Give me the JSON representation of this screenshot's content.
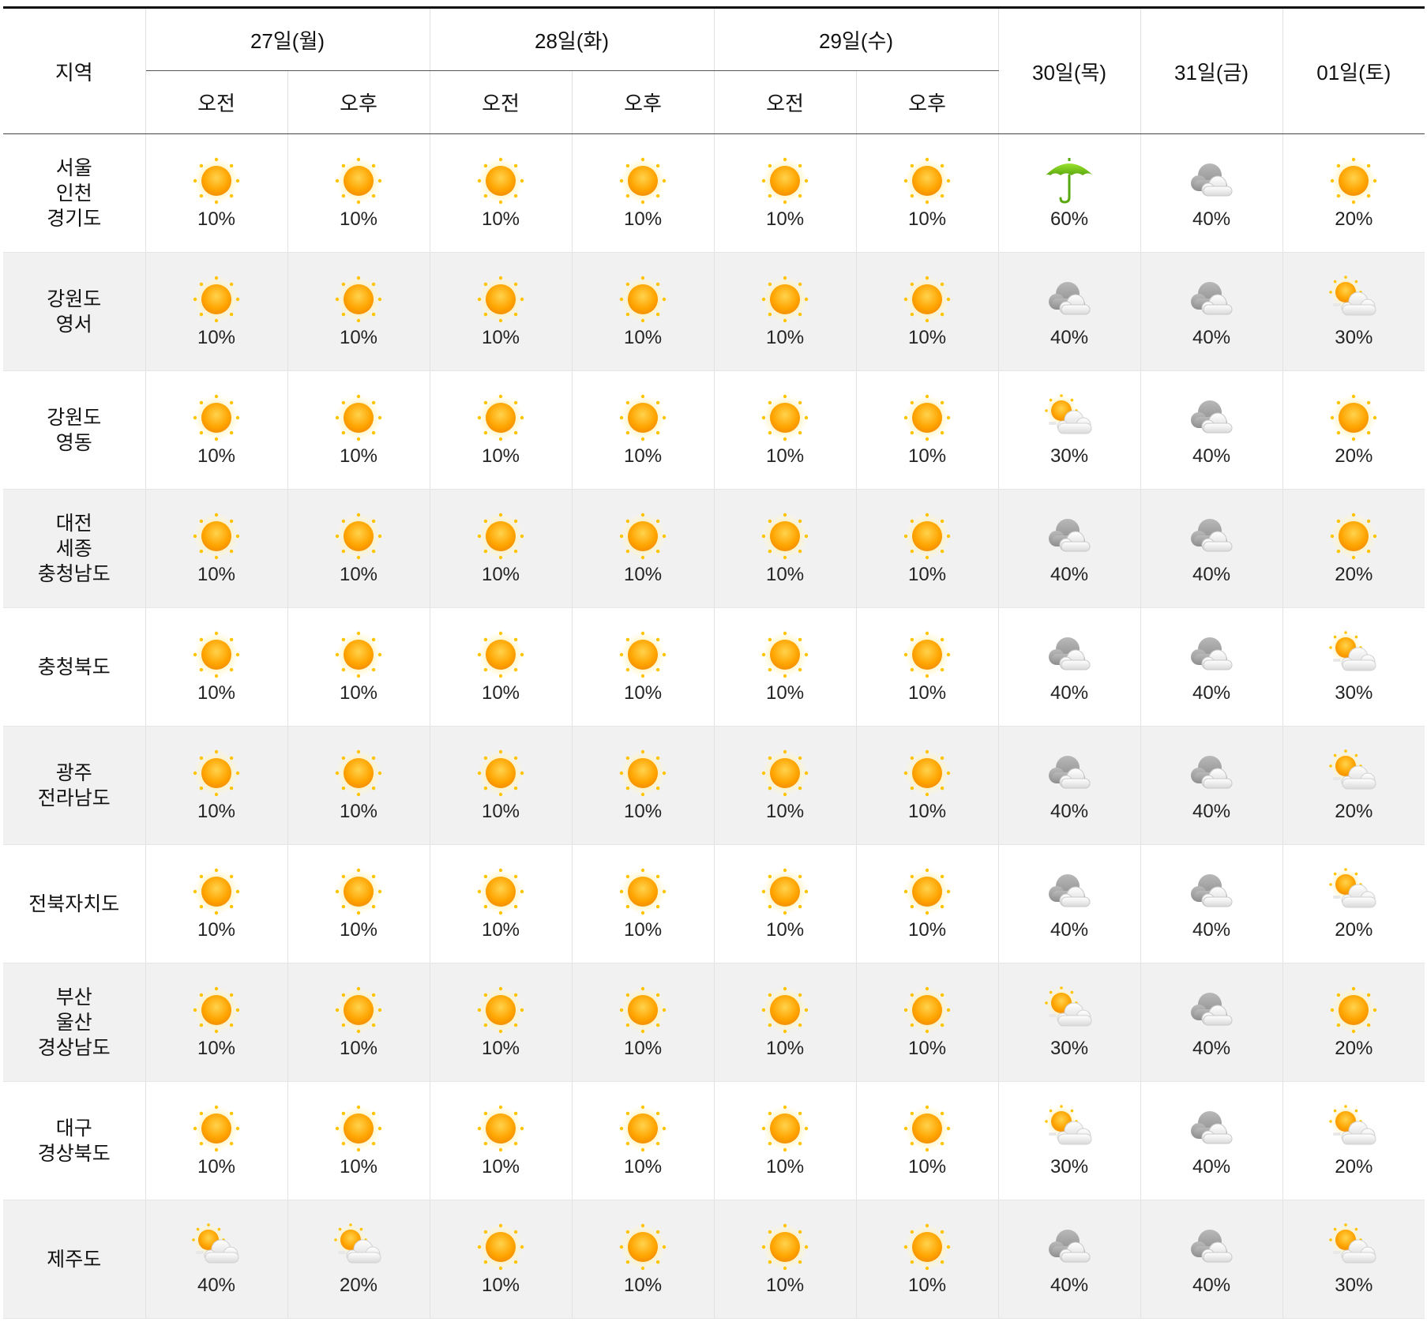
{
  "header": {
    "region_label": "지역",
    "split_days": [
      {
        "label": "27일(월)",
        "am": "오전",
        "pm": "오후"
      },
      {
        "label": "28일(화)",
        "am": "오전",
        "pm": "오후"
      },
      {
        "label": "29일(수)",
        "am": "오전",
        "pm": "오후"
      }
    ],
    "single_days": [
      "30일(목)",
      "31일(금)",
      "01일(토)"
    ]
  },
  "rows": [
    {
      "region": "서울\n인천\n경기도",
      "cells": [
        {
          "icon": "sun-icon",
          "pct": "10%"
        },
        {
          "icon": "sun-icon",
          "pct": "10%"
        },
        {
          "icon": "sun-icon",
          "pct": "10%"
        },
        {
          "icon": "sun-icon",
          "pct": "10%"
        },
        {
          "icon": "sun-icon",
          "pct": "10%"
        },
        {
          "icon": "sun-icon",
          "pct": "10%"
        },
        {
          "icon": "umbrella-icon",
          "pct": "60%"
        },
        {
          "icon": "cloud-icon",
          "pct": "40%"
        },
        {
          "icon": "sun-icon",
          "pct": "20%"
        }
      ]
    },
    {
      "region": "강원도\n영서",
      "cells": [
        {
          "icon": "sun-icon",
          "pct": "10%"
        },
        {
          "icon": "sun-icon",
          "pct": "10%"
        },
        {
          "icon": "sun-icon",
          "pct": "10%"
        },
        {
          "icon": "sun-icon",
          "pct": "10%"
        },
        {
          "icon": "sun-icon",
          "pct": "10%"
        },
        {
          "icon": "sun-icon",
          "pct": "10%"
        },
        {
          "icon": "cloud-icon",
          "pct": "40%"
        },
        {
          "icon": "cloud-icon",
          "pct": "40%"
        },
        {
          "icon": "partly-cloudy-icon",
          "pct": "30%"
        }
      ]
    },
    {
      "region": "강원도\n영동",
      "cells": [
        {
          "icon": "sun-icon",
          "pct": "10%"
        },
        {
          "icon": "sun-icon",
          "pct": "10%"
        },
        {
          "icon": "sun-icon",
          "pct": "10%"
        },
        {
          "icon": "sun-icon",
          "pct": "10%"
        },
        {
          "icon": "sun-icon",
          "pct": "10%"
        },
        {
          "icon": "sun-icon",
          "pct": "10%"
        },
        {
          "icon": "partly-cloudy-icon",
          "pct": "30%"
        },
        {
          "icon": "cloud-icon",
          "pct": "40%"
        },
        {
          "icon": "sun-icon",
          "pct": "20%"
        }
      ]
    },
    {
      "region": "대전\n세종\n충청남도",
      "cells": [
        {
          "icon": "sun-icon",
          "pct": "10%"
        },
        {
          "icon": "sun-icon",
          "pct": "10%"
        },
        {
          "icon": "sun-icon",
          "pct": "10%"
        },
        {
          "icon": "sun-icon",
          "pct": "10%"
        },
        {
          "icon": "sun-icon",
          "pct": "10%"
        },
        {
          "icon": "sun-icon",
          "pct": "10%"
        },
        {
          "icon": "cloud-icon",
          "pct": "40%"
        },
        {
          "icon": "cloud-icon",
          "pct": "40%"
        },
        {
          "icon": "sun-icon",
          "pct": "20%"
        }
      ]
    },
    {
      "region": "충청북도",
      "cells": [
        {
          "icon": "sun-icon",
          "pct": "10%"
        },
        {
          "icon": "sun-icon",
          "pct": "10%"
        },
        {
          "icon": "sun-icon",
          "pct": "10%"
        },
        {
          "icon": "sun-icon",
          "pct": "10%"
        },
        {
          "icon": "sun-icon",
          "pct": "10%"
        },
        {
          "icon": "sun-icon",
          "pct": "10%"
        },
        {
          "icon": "cloud-icon",
          "pct": "40%"
        },
        {
          "icon": "cloud-icon",
          "pct": "40%"
        },
        {
          "icon": "partly-cloudy-icon",
          "pct": "30%"
        }
      ]
    },
    {
      "region": "광주\n전라남도",
      "cells": [
        {
          "icon": "sun-icon",
          "pct": "10%"
        },
        {
          "icon": "sun-icon",
          "pct": "10%"
        },
        {
          "icon": "sun-icon",
          "pct": "10%"
        },
        {
          "icon": "sun-icon",
          "pct": "10%"
        },
        {
          "icon": "sun-icon",
          "pct": "10%"
        },
        {
          "icon": "sun-icon",
          "pct": "10%"
        },
        {
          "icon": "cloud-icon",
          "pct": "40%"
        },
        {
          "icon": "cloud-icon",
          "pct": "40%"
        },
        {
          "icon": "partly-cloudy-icon",
          "pct": "20%"
        }
      ]
    },
    {
      "region": "전북자치도",
      "cells": [
        {
          "icon": "sun-icon",
          "pct": "10%"
        },
        {
          "icon": "sun-icon",
          "pct": "10%"
        },
        {
          "icon": "sun-icon",
          "pct": "10%"
        },
        {
          "icon": "sun-icon",
          "pct": "10%"
        },
        {
          "icon": "sun-icon",
          "pct": "10%"
        },
        {
          "icon": "sun-icon",
          "pct": "10%"
        },
        {
          "icon": "cloud-icon",
          "pct": "40%"
        },
        {
          "icon": "cloud-icon",
          "pct": "40%"
        },
        {
          "icon": "partly-cloudy-icon",
          "pct": "20%"
        }
      ]
    },
    {
      "region": "부산\n울산\n경상남도",
      "cells": [
        {
          "icon": "sun-icon",
          "pct": "10%"
        },
        {
          "icon": "sun-icon",
          "pct": "10%"
        },
        {
          "icon": "sun-icon",
          "pct": "10%"
        },
        {
          "icon": "sun-icon",
          "pct": "10%"
        },
        {
          "icon": "sun-icon",
          "pct": "10%"
        },
        {
          "icon": "sun-icon",
          "pct": "10%"
        },
        {
          "icon": "partly-cloudy-icon",
          "pct": "30%"
        },
        {
          "icon": "cloud-icon",
          "pct": "40%"
        },
        {
          "icon": "sun-icon",
          "pct": "20%"
        }
      ]
    },
    {
      "region": "대구\n경상북도",
      "cells": [
        {
          "icon": "sun-icon",
          "pct": "10%"
        },
        {
          "icon": "sun-icon",
          "pct": "10%"
        },
        {
          "icon": "sun-icon",
          "pct": "10%"
        },
        {
          "icon": "sun-icon",
          "pct": "10%"
        },
        {
          "icon": "sun-icon",
          "pct": "10%"
        },
        {
          "icon": "sun-icon",
          "pct": "10%"
        },
        {
          "icon": "partly-cloudy-icon",
          "pct": "30%"
        },
        {
          "icon": "cloud-icon",
          "pct": "40%"
        },
        {
          "icon": "partly-cloudy-icon",
          "pct": "20%"
        }
      ]
    },
    {
      "region": "제주도",
      "cells": [
        {
          "icon": "partly-cloudy-icon",
          "pct": "40%"
        },
        {
          "icon": "partly-cloudy-icon",
          "pct": "20%"
        },
        {
          "icon": "sun-icon",
          "pct": "10%"
        },
        {
          "icon": "sun-icon",
          "pct": "10%"
        },
        {
          "icon": "sun-icon",
          "pct": "10%"
        },
        {
          "icon": "sun-icon",
          "pct": "10%"
        },
        {
          "icon": "cloud-icon",
          "pct": "40%"
        },
        {
          "icon": "cloud-icon",
          "pct": "40%"
        },
        {
          "icon": "partly-cloudy-icon",
          "pct": "30%"
        }
      ]
    }
  ]
}
